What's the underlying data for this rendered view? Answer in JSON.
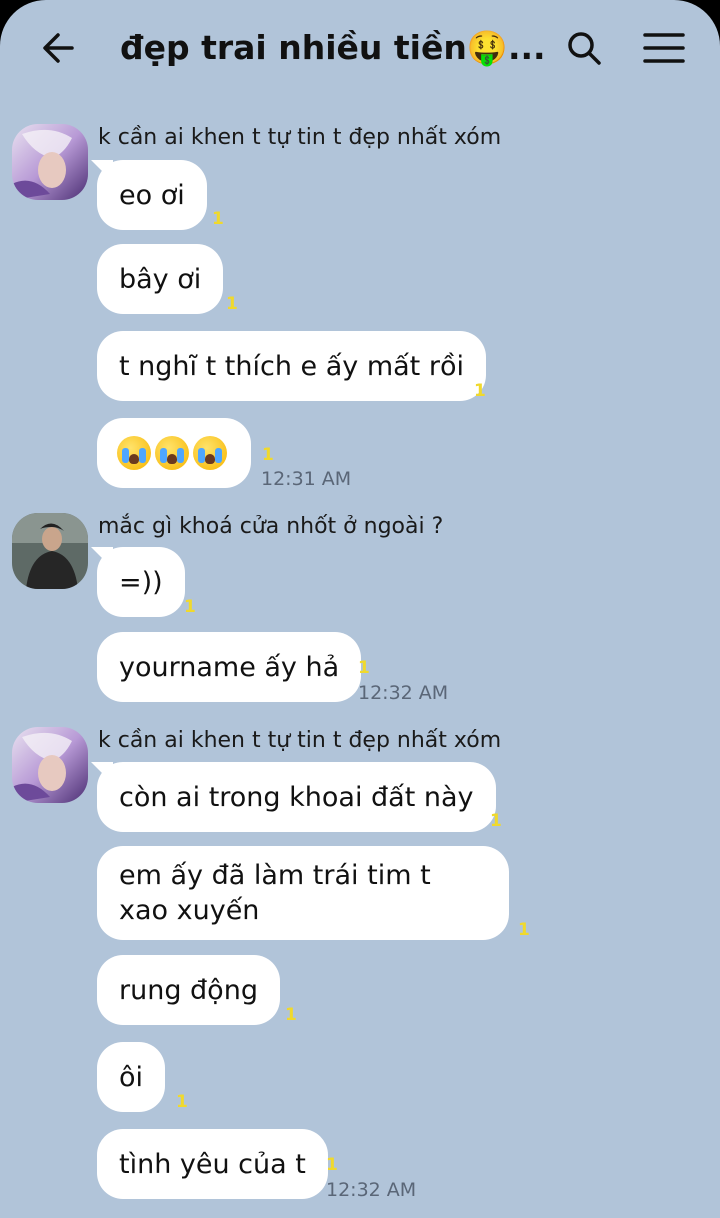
{
  "header": {
    "title": "đẹp trai nhiều tiền🤑..."
  },
  "colors": {
    "background": "#b1c4d9",
    "bubble": "#ffffff",
    "read_count": "#f0d92c"
  },
  "groups": [
    {
      "sender": "k cần ai khen t tự tin t đẹp nhất xóm",
      "avatar": "purple-haired-person-avatar",
      "messages": [
        {
          "text": "eo ơi",
          "read": "1"
        },
        {
          "text": "bây ơi",
          "read": "1"
        },
        {
          "text": "t nghĩ t thích e ấy mất rồi",
          "read": "1"
        },
        {
          "text": "😭😭😭",
          "read": "1",
          "time": "12:31 AM"
        }
      ]
    },
    {
      "sender": "mắc gì khoá cửa nhốt ở ngoài ?",
      "avatar": "dark-jacket-person-avatar",
      "messages": [
        {
          "text": "=))",
          "read": "1"
        },
        {
          "text": "yourname ấy hả",
          "read": "1",
          "time": "12:32 AM"
        }
      ]
    },
    {
      "sender": "k cần ai khen t tự tin t đẹp nhất xóm",
      "avatar": "purple-haired-person-avatar",
      "messages": [
        {
          "text": "còn ai trong khoai đất này",
          "read": "1"
        },
        {
          "text": "em ấy đã làm trái tim t xao xuyến",
          "read": "1"
        },
        {
          "text": "rung động",
          "read": "1"
        },
        {
          "text": "ôi",
          "read": "1"
        },
        {
          "text": "tình yêu của t",
          "read": "1",
          "time": "12:32 AM"
        }
      ]
    }
  ]
}
